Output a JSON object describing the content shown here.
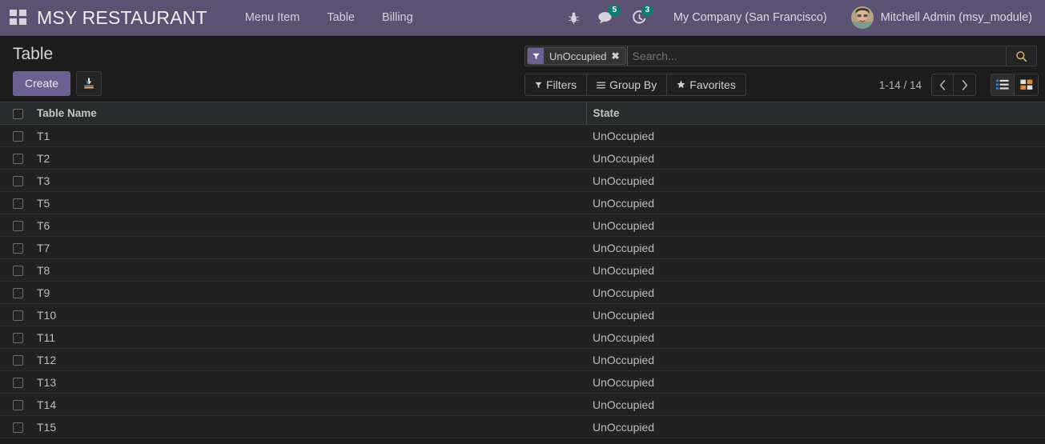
{
  "navbar": {
    "apps_icon": "apps-grid-icon",
    "brand": "MSY RESTAURANT",
    "menu": [
      {
        "label": "Menu Item"
      },
      {
        "label": "Table"
      },
      {
        "label": "Billing"
      }
    ],
    "icons": {
      "debug": "bug-icon",
      "messages": "chat-bubble-icon",
      "messages_count": "5",
      "activities": "activity-clock-icon",
      "activities_count": "3"
    },
    "company": "My Company (San Francisco)",
    "user": "Mitchell Admin (msy_module)",
    "avatar": "user-avatar",
    "background_color": "#5b5273"
  },
  "control_panel": {
    "title": "Table",
    "create_label": "Create",
    "import_icon": "import-upload-icon",
    "accent_color": "#6c6090",
    "search": {
      "facet_icon": "filter-funnel-icon",
      "facet_label": "UnOccupied",
      "facet_remove": "✖",
      "placeholder": "Search...",
      "value": "",
      "search_icon": "search-magnifier-icon"
    },
    "buttons": [
      {
        "name": "filters",
        "icon": "funnel-icon",
        "label": "Filters"
      },
      {
        "name": "group-by",
        "icon": "hamburger-lines-icon",
        "label": "Group By"
      },
      {
        "name": "favorites",
        "icon": "star-icon",
        "label": "Favorites"
      }
    ],
    "pager": {
      "range": "1-14 / 14",
      "prev_icon": "chevron-left-icon",
      "next_icon": "chevron-right-icon"
    },
    "views": [
      {
        "name": "list",
        "icon": "list-view-icon",
        "active": true
      },
      {
        "name": "kanban",
        "icon": "kanban-view-icon",
        "active": false
      }
    ]
  },
  "list": {
    "columns": [
      "",
      "Table Name",
      "State"
    ],
    "rows": [
      {
        "name": "T1",
        "state": "UnOccupied"
      },
      {
        "name": "T2",
        "state": "UnOccupied"
      },
      {
        "name": "T3",
        "state": "UnOccupied"
      },
      {
        "name": "T5",
        "state": "UnOccupied"
      },
      {
        "name": "T6",
        "state": "UnOccupied"
      },
      {
        "name": "T7",
        "state": "UnOccupied"
      },
      {
        "name": "T8",
        "state": "UnOccupied"
      },
      {
        "name": "T9",
        "state": "UnOccupied"
      },
      {
        "name": "T10",
        "state": "UnOccupied"
      },
      {
        "name": "T11",
        "state": "UnOccupied"
      },
      {
        "name": "T12",
        "state": "UnOccupied"
      },
      {
        "name": "T13",
        "state": "UnOccupied"
      },
      {
        "name": "T14",
        "state": "UnOccupied"
      },
      {
        "name": "T15",
        "state": "UnOccupied"
      }
    ]
  }
}
